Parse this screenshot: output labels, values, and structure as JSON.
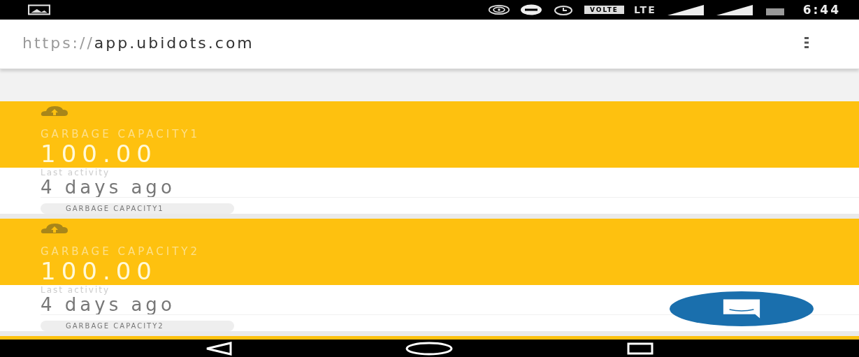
{
  "status_bar": {
    "volte": "VOLTE",
    "network": "LTE",
    "time": "6:44"
  },
  "address_bar": {
    "scheme": "https://",
    "host": "app.ubidots.com"
  },
  "cards": [
    {
      "name": "GARBAGE CAPACITY1",
      "value": "100.00",
      "activity_label": "Last activity",
      "activity": "4 days ago",
      "tag": "GARBAGE CAPACITY1"
    },
    {
      "name": "GARBAGE CAPACITY2",
      "value": "100.00",
      "activity_label": "Last activity",
      "activity": "4 days ago",
      "tag": "GARBAGE CAPACITY2"
    }
  ]
}
